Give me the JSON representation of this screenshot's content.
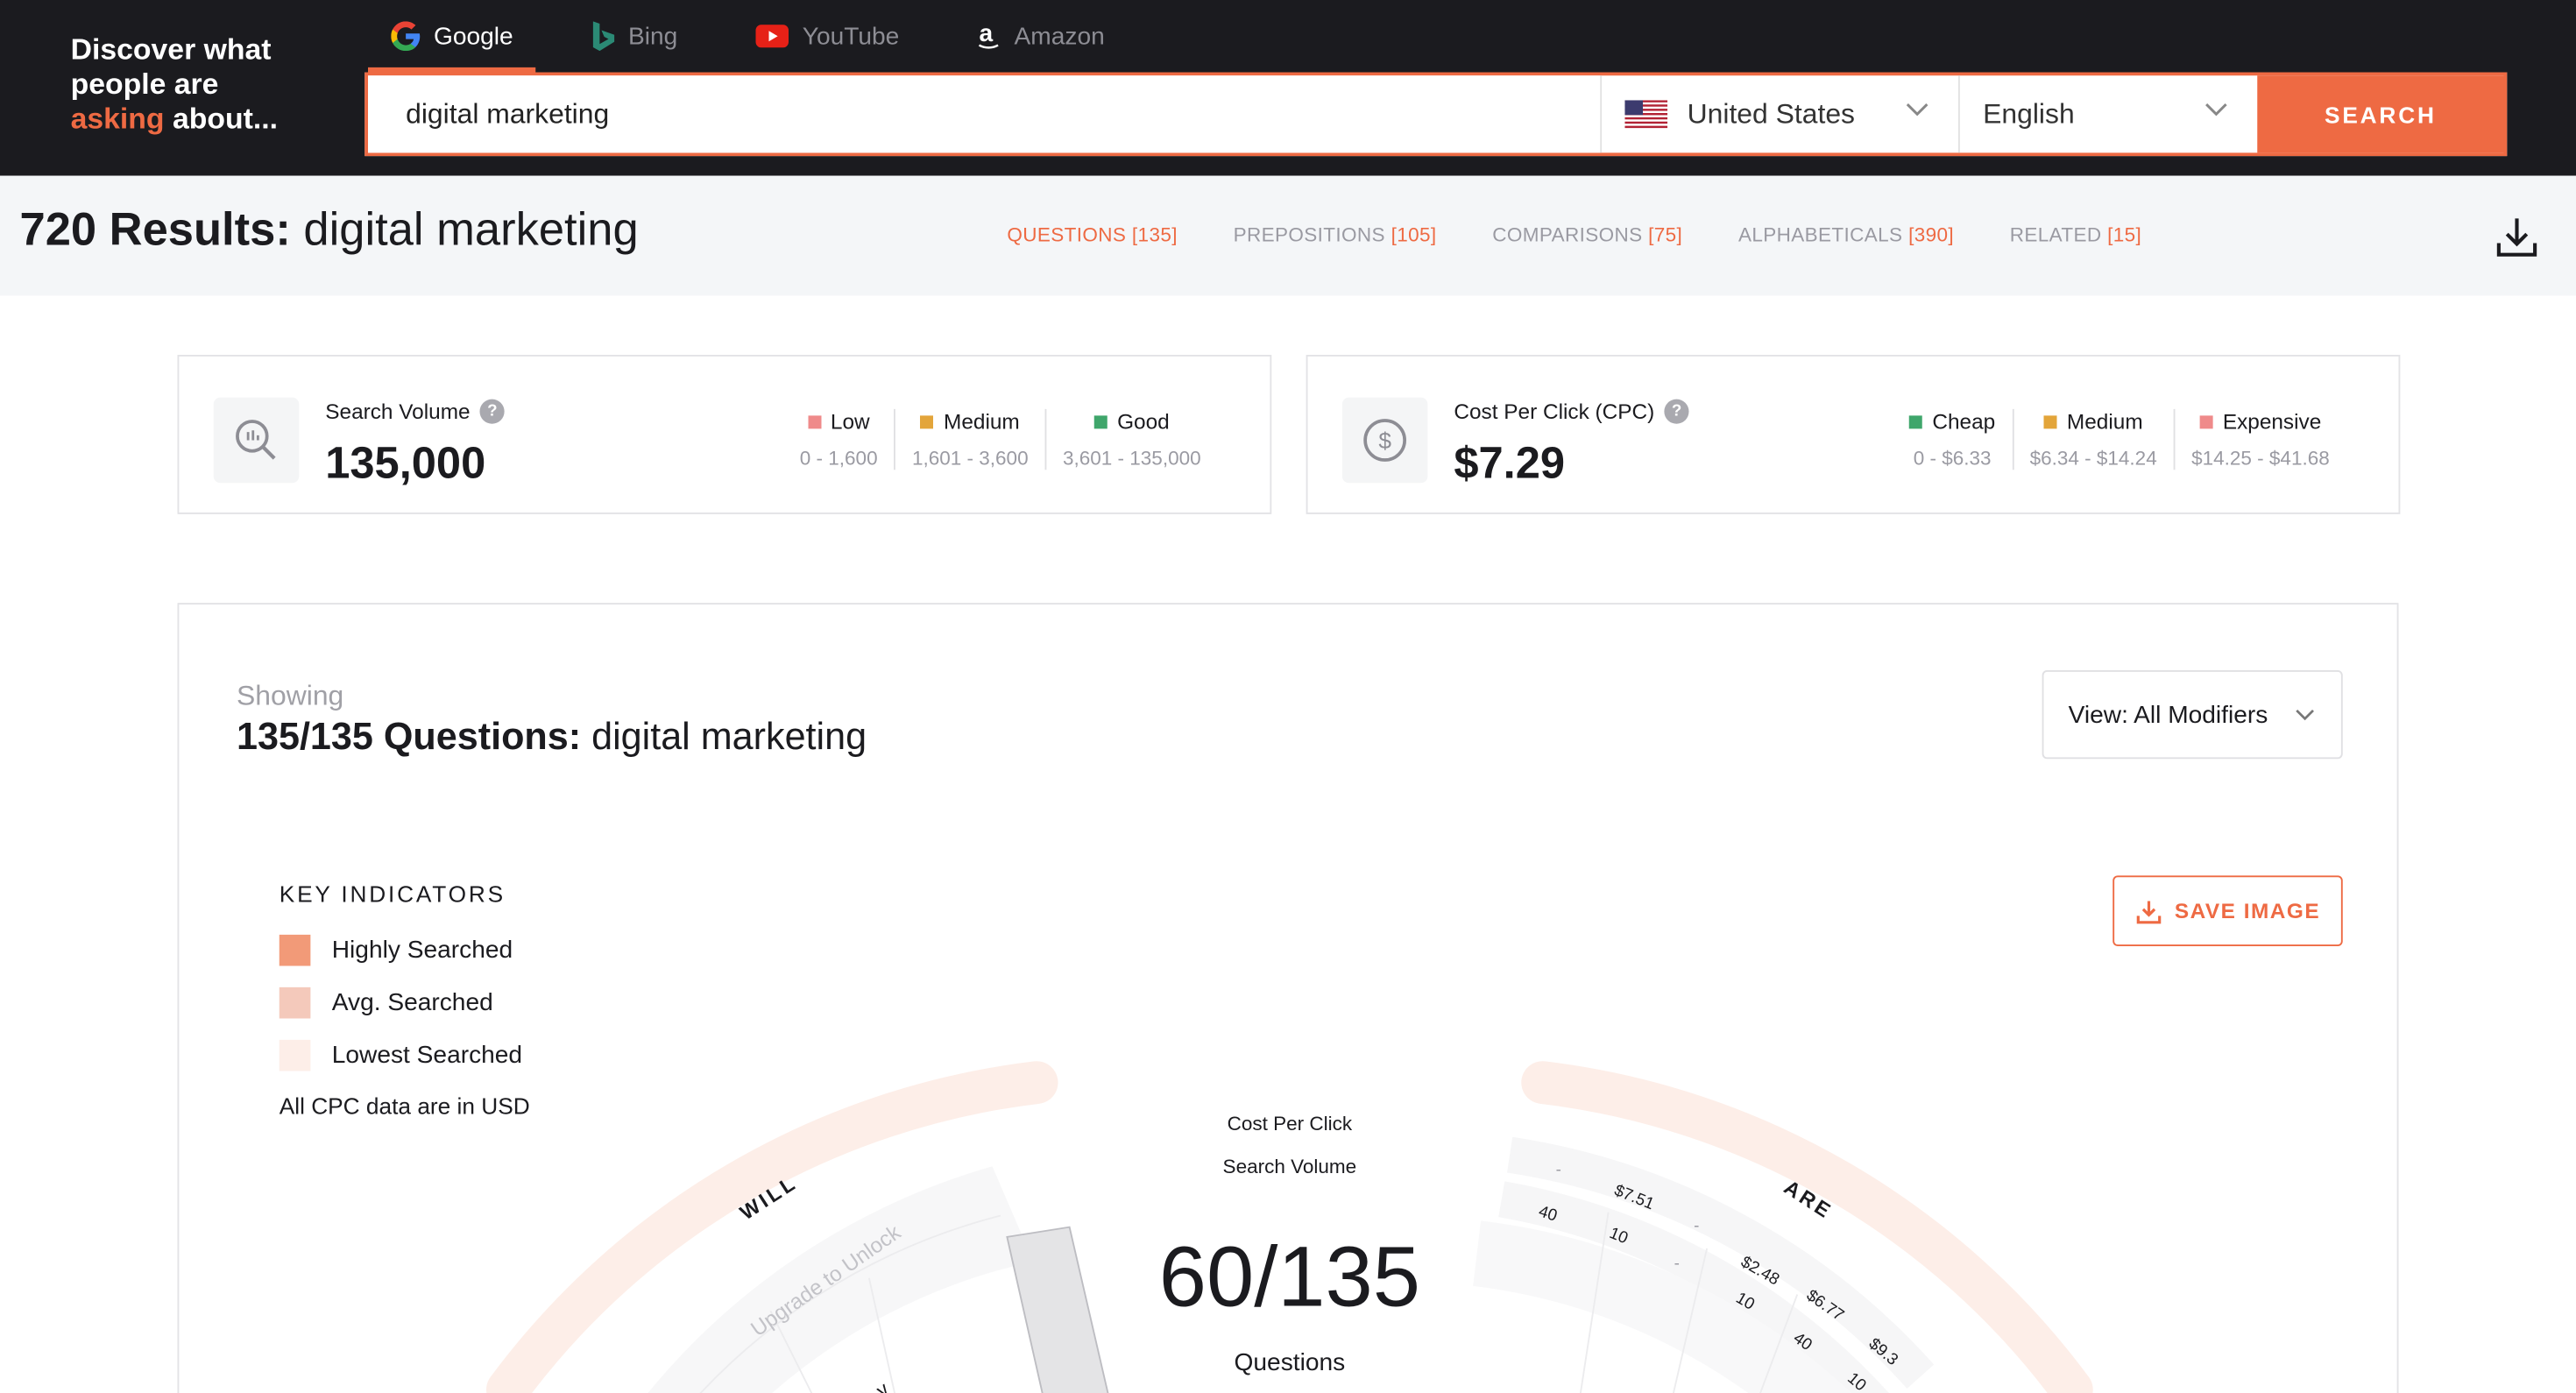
{
  "header": {
    "tagline_line1": "Discover what",
    "tagline_line2": "people are",
    "tagline_highlight": "asking",
    "tagline_tail": "about...",
    "engines": [
      {
        "label": "Google",
        "icon": "google-icon",
        "active": true
      },
      {
        "label": "Bing",
        "icon": "bing-icon",
        "active": false
      },
      {
        "label": "YouTube",
        "icon": "youtube-icon",
        "active": false
      },
      {
        "label": "Amazon",
        "icon": "amazon-icon",
        "active": false
      }
    ],
    "search_value": "digital marketing",
    "country": "United States",
    "language": "English",
    "search_button": "SEARCH"
  },
  "results": {
    "count_label": "720 Results:",
    "keyword": "digital marketing",
    "tabs": [
      {
        "label": "QUESTIONS",
        "count": "[135]",
        "active": true
      },
      {
        "label": "PREPOSITIONS",
        "count": "[105]",
        "active": false
      },
      {
        "label": "COMPARISONS",
        "count": "[75]",
        "active": false
      },
      {
        "label": "ALPHABETICALS",
        "count": "[390]",
        "active": false
      },
      {
        "label": "RELATED",
        "count": "[15]",
        "active": false
      }
    ]
  },
  "search_volume": {
    "label": "Search Volume",
    "value": "135,000",
    "legend": [
      {
        "name": "Low",
        "range": "0 - 1,600",
        "color": "#ef8a8a"
      },
      {
        "name": "Medium",
        "range": "1,601 - 3,600",
        "color": "#e3a53a"
      },
      {
        "name": "Good",
        "range": "3,601 - 135,000",
        "color": "#3fa66b"
      }
    ]
  },
  "cpc": {
    "label": "Cost Per Click (CPC)",
    "value": "$7.29",
    "legend": [
      {
        "name": "Cheap",
        "range": "0 - $6.33",
        "color": "#3fa66b"
      },
      {
        "name": "Medium",
        "range": "$6.34 - $14.24",
        "color": "#e3a53a"
      },
      {
        "name": "Expensive",
        "range": "$14.25 - $41.68",
        "color": "#ef8a8a"
      }
    ]
  },
  "panel": {
    "showing": "Showing",
    "count": "135/135 Questions:",
    "keyword": "digital marketing",
    "view_label": "View: All Modifiers",
    "key_title": "KEY INDICATORS",
    "indicators": [
      {
        "label": "Highly Searched",
        "color": "#f29a78"
      },
      {
        "label": "Avg. Searched",
        "color": "#f4c9bb"
      },
      {
        "label": "Lowest Searched",
        "color": "#fdeee8"
      }
    ],
    "cpc_note": "All CPC data are in USD",
    "save_label": "SAVE IMAGE",
    "center": {
      "cpc": "Cost Per Click",
      "sv": "Search Volume",
      "count": "60/135",
      "unit": "Questions"
    },
    "wheel": {
      "left_label": "WILL",
      "right_label": "ARE",
      "locked": "Upgrade to Unlock",
      "right_cpc": [
        "$7.51",
        "$2.48",
        "$6.77",
        "$9.3"
      ],
      "right_sv": [
        "40",
        "10",
        "10",
        "40",
        "10"
      ]
    }
  },
  "colors": {
    "accent": "#ee6a43",
    "dark": "#1b1b1f"
  }
}
